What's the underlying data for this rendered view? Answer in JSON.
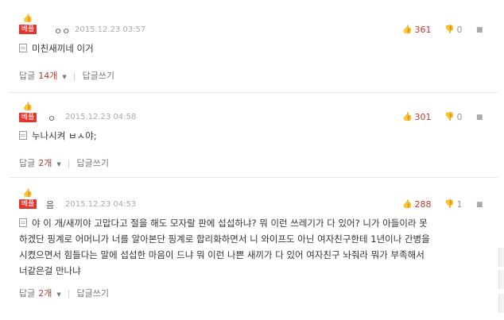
{
  "best_label": "베플",
  "reply_label": "답글",
  "write_reply_label": "답글쓰기",
  "comments": [
    {
      "author": "ㅇㅇ",
      "date": "2015.12.23 03:57",
      "up": "361",
      "down": "0",
      "text": "미친새끼네 이거",
      "reply_count": "14개"
    },
    {
      "author": "ㅇ",
      "date": "2015.12.23 04:58",
      "up": "301",
      "down": "0",
      "text": "누나시켜 ㅂㅅ야;",
      "reply_count": "2개"
    },
    {
      "author": "음",
      "date": "2015.12.23 04:53",
      "up": "288",
      "down": "1",
      "text_lines": [
        "야 이 개/새끼야 고맙다고 절을 해도 모자랄 판에 섭섭하냐? 뭐 이런 쓰레기가 다 있어? 니가 아들이라 못",
        "하겠단 핑계로 어머니가 너를 알아본단 핑계로 합리화하면서 니 와이프도 아닌 여자친구한테 1년이나 간병을",
        "시켰으면서 힘들다는 말에 섭섭한 마음이 드냐 뭐 이런 나쁜 새끼가 다 있어 여자친구 놔줘라 뭐가 부족해서",
        "너같은걸 만나냐"
      ],
      "reply_count": "2개"
    }
  ]
}
